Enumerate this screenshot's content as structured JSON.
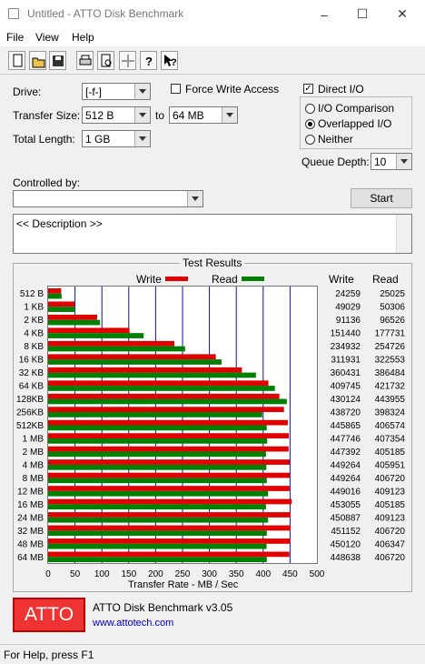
{
  "window": {
    "title": "Untitled - ATTO Disk Benchmark",
    "minimize": "–",
    "maximize": "☐",
    "close": "✕"
  },
  "menu": [
    "File",
    "View",
    "Help"
  ],
  "toolbar": [
    "new-icon",
    "open-icon",
    "save-icon",
    "print-icon",
    "print-preview-icon",
    "move-icon",
    "help-icon",
    "context-help-icon"
  ],
  "settings": {
    "drive_label": "Drive:",
    "drive_value": "[-f-]",
    "transfer_size_label": "Transfer Size:",
    "transfer_from": "512 B",
    "to_label": "to",
    "transfer_to": "64 MB",
    "total_length_label": "Total Length:",
    "total_length": "1 GB",
    "force_write_label": "Force Write Access",
    "force_write_checked": false,
    "direct_io_label": "Direct I/O",
    "direct_io_checked": true,
    "io_comparison_label": "I/O Comparison",
    "overlapped_io_label": "Overlapped I/O",
    "neither_label": "Neither",
    "io_mode_selected": "Overlapped I/O",
    "queue_depth_label": "Queue Depth:",
    "queue_depth": "10",
    "controlled_by_label": "Controlled by:",
    "controlled_by": "",
    "start_label": "Start",
    "description": "<< Description >>"
  },
  "results": {
    "group_title": "Test Results",
    "legend_write": "Write",
    "legend_read": "Read",
    "col_write": "Write",
    "col_read": "Read",
    "write_color": "#e00000",
    "read_color": "#008000"
  },
  "chart_data": {
    "type": "bar",
    "orientation": "horizontal",
    "xlabel": "Transfer Rate - MB / Sec",
    "xlim": [
      0,
      500
    ],
    "xticks": [
      0,
      50,
      100,
      150,
      200,
      250,
      300,
      350,
      400,
      450,
      500
    ],
    "categories": [
      "512 B",
      "1 KB",
      "2 KB",
      "4 KB",
      "8 KB",
      "16 KB",
      "32 KB",
      "64 KB",
      "128KB",
      "256KB",
      "512KB",
      "1 MB",
      "2 MB",
      "4 MB",
      "8 MB",
      "12 MB",
      "16 MB",
      "24 MB",
      "32 MB",
      "48 MB",
      "64 MB"
    ],
    "series": [
      {
        "name": "Write",
        "values": [
          24259,
          49029,
          91136,
          151440,
          234932,
          311931,
          360431,
          409745,
          430124,
          438720,
          445865,
          447746,
          447392,
          449264,
          449264,
          449016,
          453055,
          450887,
          451152,
          450120,
          448638
        ]
      },
      {
        "name": "Read",
        "values": [
          25025,
          50306,
          96526,
          177731,
          254726,
          322553,
          386484,
          421732,
          443955,
          398324,
          406574,
          407354,
          405185,
          405951,
          406720,
          409123,
          405185,
          409123,
          406720,
          406347,
          406720
        ]
      }
    ],
    "value_unit_note": "KB/s",
    "grid": true,
    "legend": "top"
  },
  "footer": {
    "logo_text": "ATTO",
    "product": "ATTO Disk Benchmark v3.05",
    "website": "www.attotech.com"
  },
  "status": "For Help, press F1"
}
